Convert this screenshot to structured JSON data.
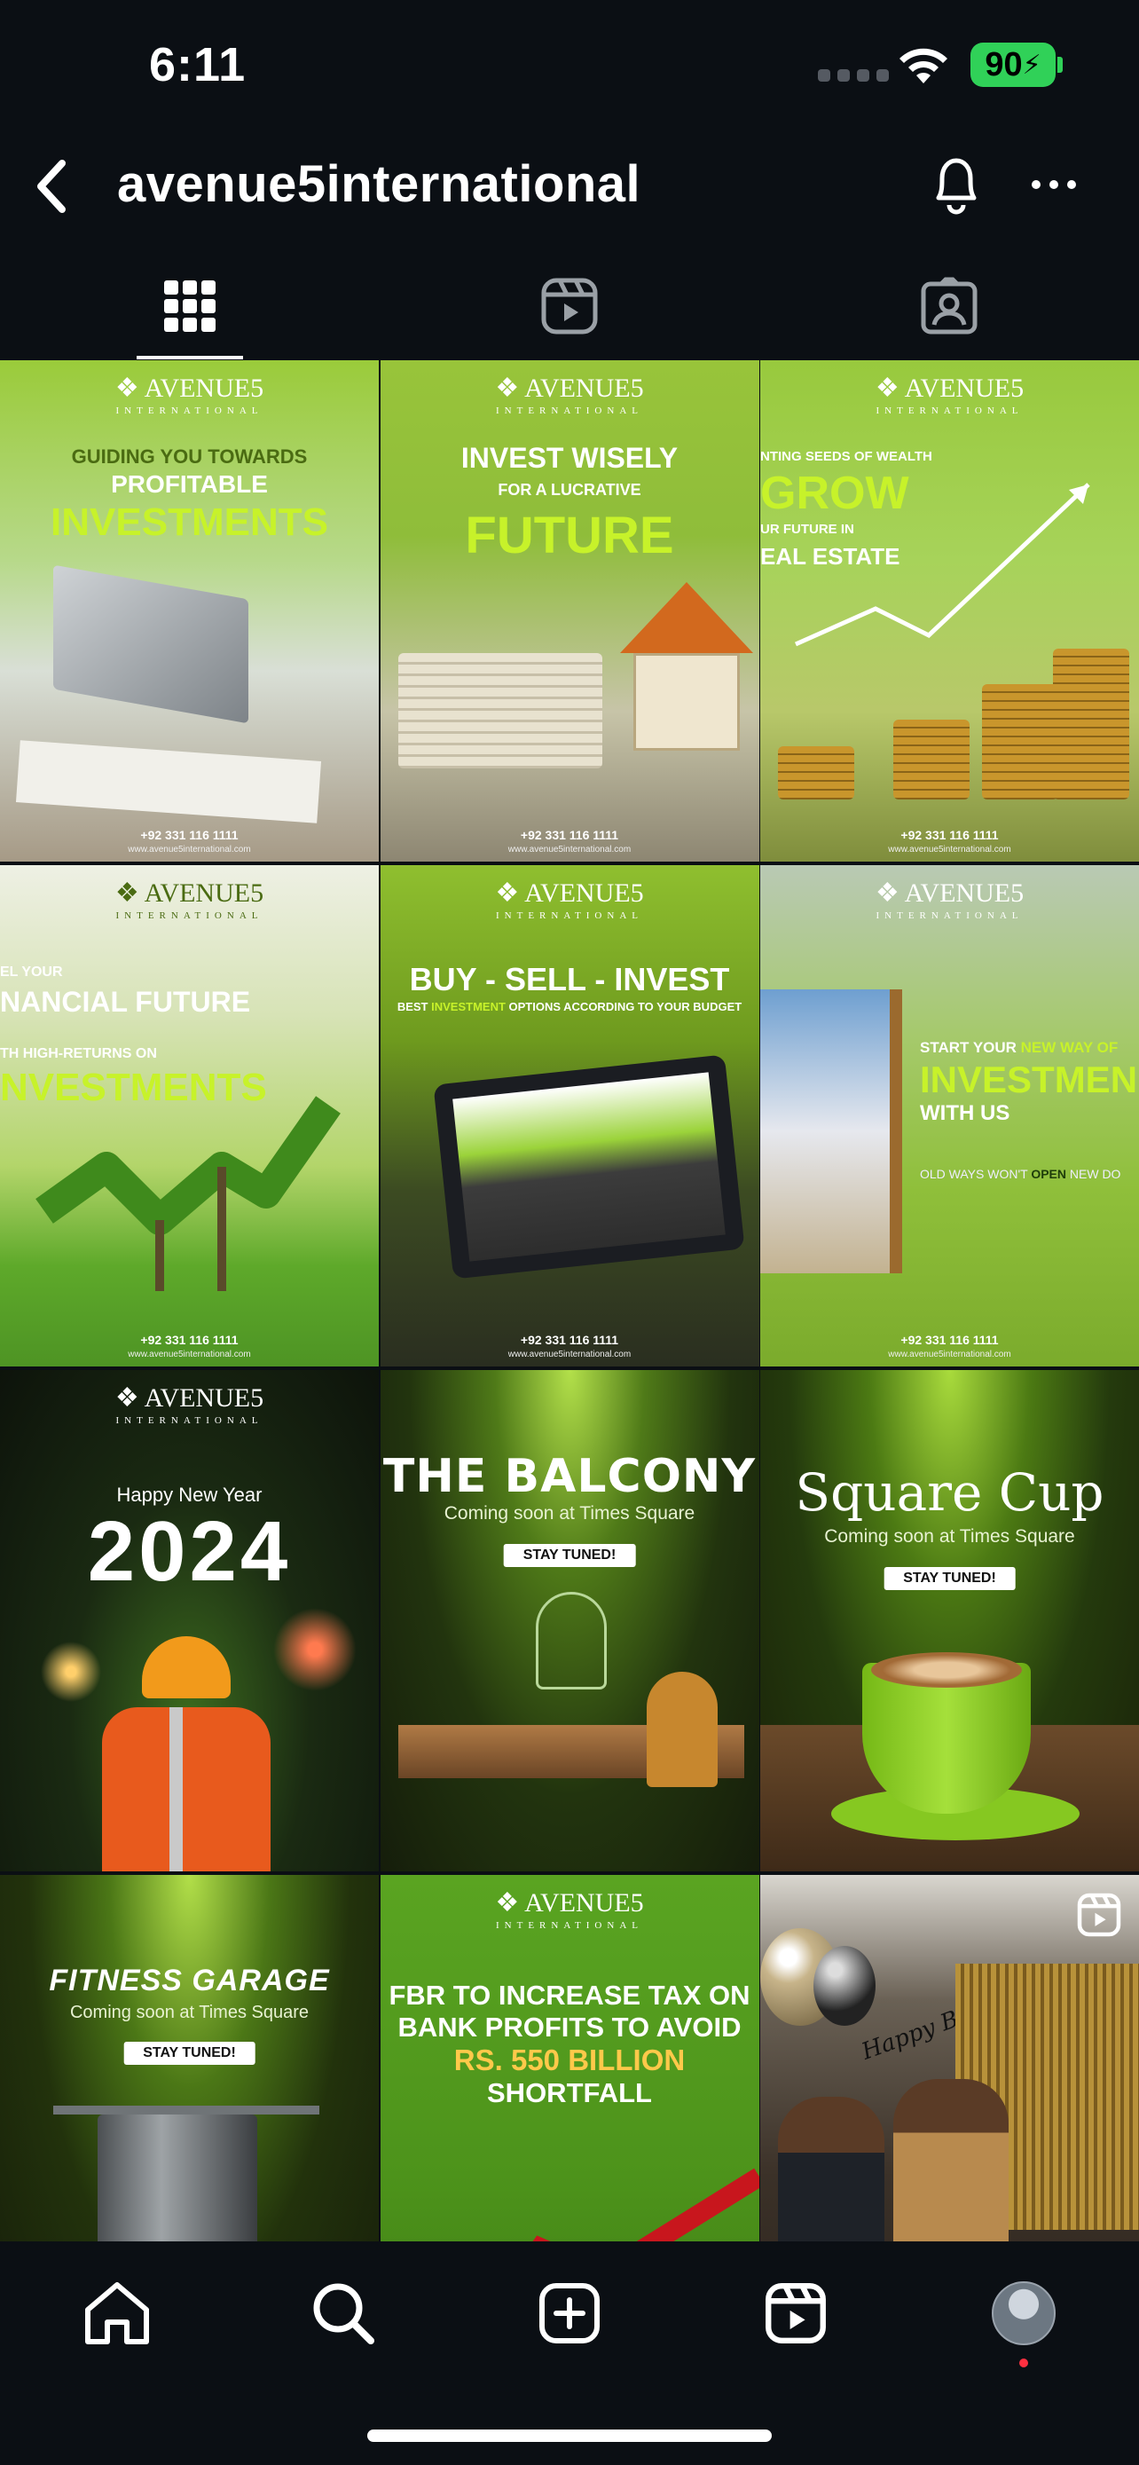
{
  "status_bar": {
    "time": "6:11",
    "battery": "90"
  },
  "header": {
    "username": "avenue5international"
  },
  "tabs": [
    {
      "name": "grid",
      "icon": "grid-icon",
      "active": true
    },
    {
      "name": "reels",
      "icon": "reels-icon",
      "active": false
    },
    {
      "name": "tagged",
      "icon": "tagged-icon",
      "active": false
    }
  ],
  "brand": {
    "name": "AVENUE",
    "number": "5",
    "tag": "INTERNATIONAL",
    "phone": "+92 331 116 1111",
    "site": "www.avenue5international.com"
  },
  "posts": {
    "p1": {
      "l1": "GUIDING YOU TOWARDS",
      "l2": "PROFITABLE",
      "l3": "INVESTMENTS"
    },
    "p2": {
      "l1": "INVEST WISELY",
      "l2": "FOR A LUCRATIVE",
      "l3": "FUTURE"
    },
    "p3": {
      "l1": "NTING SEEDS OF WEALTH",
      "l2": "GROW",
      "l3": "UR FUTURE IN",
      "l4": "EAL ESTATE"
    },
    "p4": {
      "l1": "EL YOUR",
      "l2": "NANCIAL FUTURE",
      "l3": "TH HIGH-RETURNS ON",
      "l4": "NVESTMENTS"
    },
    "p5": {
      "l1": "BUY - SELL - INVEST",
      "l2a": "BEST ",
      "l2b": "INVESTMENT",
      "l2c": " OPTIONS ACCORDING TO YOUR BUDGET"
    },
    "p6": {
      "l1a": "START YOUR ",
      "l1b": "NEW WAY OF",
      "l2": "INVESTMEN",
      "l3": "WITH US",
      "l4a": "OLD WAYS WON'T ",
      "l4b": "OPEN",
      "l4c": " NEW DO"
    },
    "p7": {
      "l1": "Happy New Year",
      "l2": "2024"
    },
    "p8": {
      "l1": "THE BALCONY",
      "l2": "Coming soon at Times Square",
      "l3": "STAY TUNED!"
    },
    "p9": {
      "l1": "Square Cup",
      "l2": "Coming soon at Times Square",
      "l3": "STAY TUNED!"
    },
    "p10": {
      "l1": "FITNESS GARAGE",
      "l2": "Coming soon at Times Square",
      "l3": "STAY TUNED!"
    },
    "p11": {
      "l1": "FBR TO INCREASE TAX ON",
      "l2": "BANK PROFITS TO AVOID",
      "l3": "RS. 550 BILLION",
      "l4": "SHORTFALL"
    },
    "p12": {
      "l1": "Happy Birthday"
    }
  },
  "bottom_nav": [
    {
      "name": "home",
      "icon": "home-icon"
    },
    {
      "name": "search",
      "icon": "search-icon"
    },
    {
      "name": "create",
      "icon": "plus-square-icon"
    },
    {
      "name": "reels",
      "icon": "reels-icon"
    },
    {
      "name": "profile",
      "icon": "avatar"
    }
  ]
}
